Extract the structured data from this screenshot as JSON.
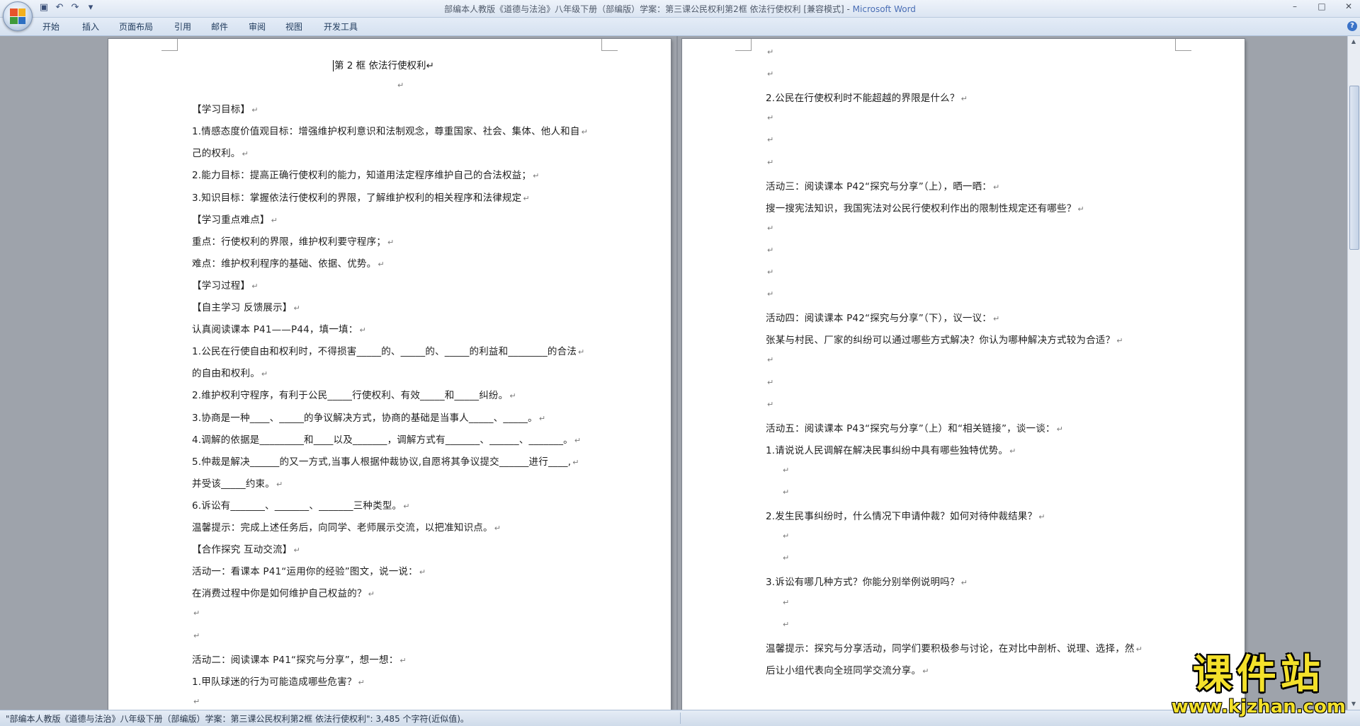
{
  "window": {
    "title": "部编本人教版《道德与法治》八年级下册（部编版）学案：第三课公民权利第2框  依法行使权利 [兼容模式] - ",
    "app_name": "Microsoft Word",
    "minimize": "–",
    "maximize": "□",
    "close": "✕"
  },
  "ribbon": {
    "tabs": [
      "开始",
      "插入",
      "页面布局",
      "引用",
      "邮件",
      "审阅",
      "视图",
      "开发工具"
    ],
    "help": "?"
  },
  "left_page": {
    "title": "第 2 框   依法行使权利",
    "lines": [
      "",
      "【学习目标】",
      "1.情感态度价值观目标：增强维护权利意识和法制观念，尊重国家、社会、集体、他人和自",
      "   己的权利。",
      "2.能力目标：提高正确行使权利的能力，知道用法定程序维护自己的合法权益；",
      "3.知识目标：掌握依法行使权利的界限，了解维护权利的相关程序和法律规定",
      "【学习重点难点】",
      "重点：行使权利的界限，维护权利要守程序；",
      "难点：维护权利程序的基础、依据、优势。",
      "【学习过程】",
      "【自主学习   反馈展示】",
      "认真阅读课本 P41——P44，填一填：",
      "1.公民在行使自由和权利时，不得损害_____的、_____的、_____的利益和________的合法",
      "的自由和权利。",
      "2.维护权利守程序，有利于公民_____行使权利、有效_____和_____纠纷。",
      "3.协商是一种____、_____的争议解决方式，协商的基础是当事人_____、_____。",
      "4.调解的依据是_________和____以及_______，调解方式有_______、______、_______。",
      "5.仲裁是解决______的又一方式,当事人根据仲裁协议,自愿将其争议提交______进行____,",
      "并受该_____约束。",
      "6.诉讼有_______、_______、_______三种类型。",
      "   温馨提示：完成上述任务后，向同学、老师展示交流，以把准知识点。",
      "【合作探究   互动交流】",
      "活动一：看课本 P41“运用你的经验”图文，说一说：",
      "在消费过程中你是如何维护自己权益的？",
      "",
      "",
      "活动二：阅读课本 P41“探究与分享”，想一想：",
      "1.甲队球迷的行为可能造成哪些危害？",
      ""
    ]
  },
  "right_page": {
    "lines": [
      "",
      "",
      "2.公民在行使权利时不能超越的界限是什么？",
      "",
      "",
      "",
      "活动三：阅读课本 P42“探究与分享”（上），晒一晒：",
      "搜一搜宪法知识，我国宪法对公民行使权利作出的限制性规定还有哪些？",
      "",
      "",
      "",
      "",
      "活动四：阅读课本 P42“探究与分享”（下），议一议：",
      "张某与村民、厂家的纠纷可以通过哪些方式解决？你认为哪种解决方式较为合适？",
      "",
      "",
      "",
      "活动五：阅读课本 P43“探究与分享”（上）和“相关链接”，谈一谈：",
      "1.请说说人民调解在解决民事纠纷中具有哪些独特优势。",
      "   ",
      "   ",
      "2.发生民事纠纷时，什么情况下申请仲裁？如何对待仲裁结果？",
      "   ",
      "   ",
      "3.诉讼有哪几种方式？你能分别举例说明吗？",
      "   ",
      "   ",
      "   温馨提示：探究与分享活动，同学们要积极参与讨论，在对比中剖析、说理、选择，然",
      "后让小组代表向全班同学交流分享。"
    ]
  },
  "paragraph_mark": "↵",
  "status": {
    "text": "\"部编本人教版《道德与法治》八年级下册（部编版）学案：第三课公民权利第2框  依法行使权利\": 3,485 个字符(近似值)。"
  },
  "watermark": {
    "main": "课件站",
    "url": "www.kjzhan.com"
  },
  "colors": {
    "office_logo": [
      "#e8542b",
      "#f2b01e",
      "#3f9a3a",
      "#2d6fc2"
    ],
    "app_name": "#4a6eb5",
    "watermark": "#f4e12a"
  }
}
